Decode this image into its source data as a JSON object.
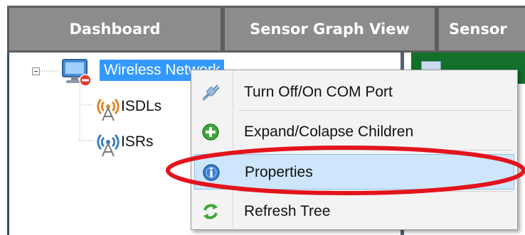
{
  "tabs": [
    {
      "label": "Dashboard"
    },
    {
      "label": "Sensor Graph View"
    },
    {
      "label": "Sensor"
    }
  ],
  "tree": {
    "root": {
      "label": "Wireless Network",
      "icon": "computer-error-icon",
      "selected": true
    },
    "children": [
      {
        "label": "ISDLs",
        "icon": "antenna-orange-icon"
      },
      {
        "label": "ISRs",
        "icon": "antenna-blue-icon"
      }
    ]
  },
  "context_menu": {
    "items": [
      {
        "label": "Turn Off/On COM Port",
        "icon": "plug-icon"
      },
      {
        "label": "Expand/Colapse Children",
        "icon": "plus-green-icon"
      },
      {
        "label": "Properties",
        "icon": "info-icon",
        "highlighted": true
      },
      {
        "label": "Refresh Tree",
        "icon": "refresh-icon"
      }
    ]
  },
  "colors": {
    "tab_bg": "#8c8c8c",
    "selection": "#3399ff",
    "menu_highlight": "#cde6fb",
    "annotation_red": "#e3141c",
    "panel_green": "#12702a"
  }
}
